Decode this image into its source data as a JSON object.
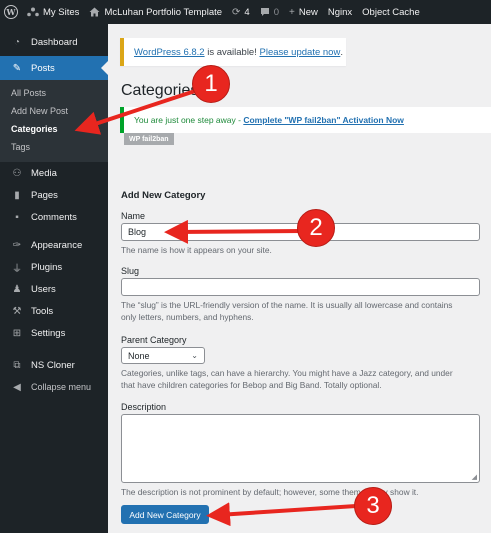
{
  "adminbar": {
    "wp_logo": "W",
    "my_sites": "My Sites",
    "site_name": "McLuhan Portfolio Template",
    "updates_count": "4",
    "comments_count": "0",
    "new_label": "New",
    "nginx_label": "Nginx",
    "object_cache_label": "Object Cache",
    "icons": {
      "sites": "network-icon",
      "home": "home-icon",
      "updates": "refresh-icon",
      "comments": "comment-icon",
      "new": "plus-icon"
    }
  },
  "sidebar": {
    "items": [
      {
        "label": "Dashboard",
        "icon": "dashboard-icon"
      },
      {
        "label": "Posts",
        "icon": "pin-icon",
        "current": true
      },
      {
        "label": "Media",
        "icon": "media-icon"
      },
      {
        "label": "Pages",
        "icon": "pages-icon"
      },
      {
        "label": "Comments",
        "icon": "comment-icon"
      },
      {
        "label": "Appearance",
        "icon": "brush-icon"
      },
      {
        "label": "Plugins",
        "icon": "plugin-icon"
      },
      {
        "label": "Users",
        "icon": "users-icon"
      },
      {
        "label": "Tools",
        "icon": "wrench-icon"
      },
      {
        "label": "Settings",
        "icon": "settings-icon"
      },
      {
        "label": "NS Cloner",
        "icon": "cloner-icon"
      },
      {
        "label": "Collapse menu",
        "icon": "collapse-icon"
      }
    ],
    "posts_submenu": [
      "All Posts",
      "Add New Post",
      "Categories",
      "Tags"
    ]
  },
  "notices": {
    "update_link": "WordPress 6.8.2",
    "update_text": " is available! ",
    "update_action": "Please update now",
    "update_period": ".",
    "success_prefix": "You are just one step away - ",
    "success_link": "Complete \"WP fail2ban\" Activation Now",
    "tag": "WP fail2ban"
  },
  "page": {
    "title": "Categories"
  },
  "form": {
    "heading": "Add New Category",
    "name_label": "Name",
    "name_value": "Blog",
    "name_help": "The name is how it appears on your site.",
    "slug_label": "Slug",
    "slug_value": "",
    "slug_help_1": "The “slug” is the URL-friendly version of the name. It is usually all lowercase and contains",
    "slug_help_2": "only letters, numbers, and hyphens.",
    "parent_label": "Parent Category",
    "parent_value": "None",
    "parent_help_1": "Categories, unlike tags, can have a hierarchy. You might have a Jazz category, and under",
    "parent_help_2": "that have children categories for Bebop and Big Band. Totally optional.",
    "description_label": "Description",
    "description_value": "",
    "description_help": "The description is not prominent by default; however, some themes may show it.",
    "submit_label": "Add New Category"
  },
  "annotations": [
    "1",
    "2",
    "3"
  ],
  "colors": {
    "admin_bg": "#1d2327",
    "accent": "#2271b1",
    "annotation": "#e8261f",
    "update_border": "#dba617",
    "success_border": "#00a32a"
  }
}
